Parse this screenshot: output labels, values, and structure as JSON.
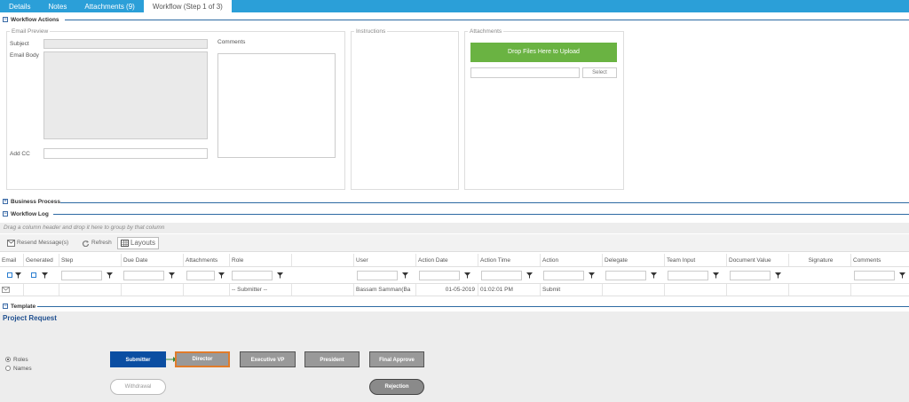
{
  "tabs": [
    "Details",
    "Notes",
    "Attachments (9)",
    "Workflow (Step 1 of 3)"
  ],
  "sections": {
    "workflow_actions": "Workflow Actions",
    "business_process": "Business Process",
    "workflow_log": "Workflow Log",
    "template": "Template"
  },
  "email_preview": {
    "legend": "Email Preview",
    "subject_label": "Subject",
    "body_label": "Email Body",
    "addcc_label": "Add CC",
    "comments_label": "Comments"
  },
  "instructions": {
    "legend": "Instructions"
  },
  "attachments": {
    "legend": "Attachments",
    "drop_label": "Drop Files Here to Upload",
    "select_label": "Select"
  },
  "group_hint": "Drag a column header and drop it here to group by that column",
  "toolbar": {
    "resend": "Resend Message(s)",
    "refresh": "Refresh",
    "layouts": "Layouts"
  },
  "columns": [
    "Email",
    "Generated",
    "Step",
    "Due Date",
    "Attachments",
    "Role",
    "",
    "User",
    "Action Date",
    "Action Time",
    "Action",
    "Delegate",
    "Team Input",
    "Document Value",
    "Signature",
    "Comments"
  ],
  "row": {
    "role": "-- Submitter --",
    "user": "Bassam Samman(Ba",
    "action_date": "01-05-2019",
    "action_time": "01:02:01 PM",
    "action": "Submit"
  },
  "template": {
    "title": "Project Request",
    "radio_roles": "Roles",
    "radio_names": "Names",
    "nodes": [
      "Submitter",
      "Director",
      "Executive VP",
      "President",
      "Final Approve"
    ],
    "withdrawal": "Withdrawal",
    "rejection": "Rejection"
  },
  "colors": {
    "tab_bar": "#2b9fd8",
    "accent": "#6ab342",
    "submitter": "#0b4ea2",
    "director_border": "#e07b2a"
  }
}
